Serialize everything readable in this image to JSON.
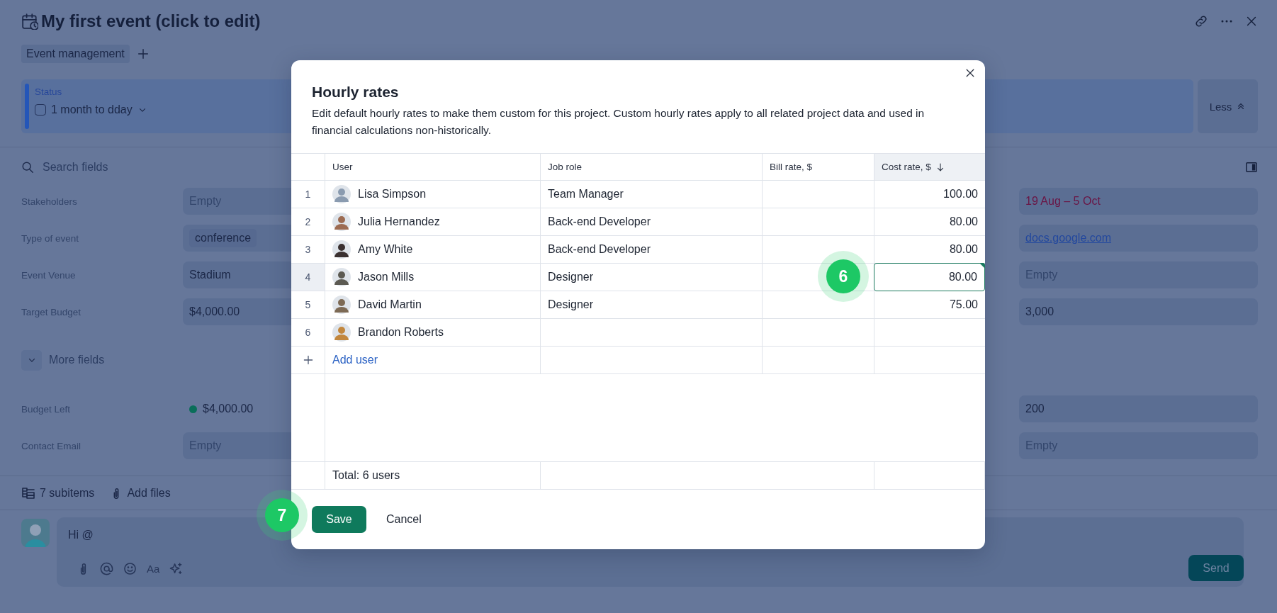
{
  "header": {
    "title": "My first event (click to edit)"
  },
  "tags": [
    {
      "label": "Event management"
    }
  ],
  "status": {
    "label": "Status",
    "value": "1 month to dday",
    "checked": false
  },
  "less_button": "Less",
  "search": {
    "placeholder": "Search fields"
  },
  "field_groups": [
    {
      "fields": [
        {
          "label": "Stakeholders",
          "value": "Empty",
          "kind": "empty"
        },
        {
          "label": "Type of event",
          "value": "conference",
          "kind": "tag"
        },
        {
          "label": "Event Venue",
          "value": "Stadium",
          "kind": "text"
        },
        {
          "label": "Target Budget",
          "value": "$4,000.00",
          "kind": "text"
        }
      ],
      "right_fields": [
        {
          "value": "19 Aug – 5 Oct",
          "kind": "date"
        },
        {
          "value": "docs.google.com",
          "kind": "link"
        },
        {
          "value": "Empty",
          "kind": "empty"
        },
        {
          "value": "3,000",
          "kind": "text"
        }
      ]
    },
    {
      "fields": [
        {
          "label": "Budget Left",
          "value": "$4,000.00",
          "kind": "dot",
          "color": "#0a6e5a"
        },
        {
          "label": "Contact Email",
          "value": "Empty",
          "kind": "empty"
        }
      ],
      "right_fields": [
        {
          "value": "200",
          "kind": "text"
        },
        {
          "value": "Empty",
          "kind": "empty"
        }
      ]
    }
  ],
  "more_fields": "More fields",
  "footer": {
    "subitems": "7 subitems",
    "add_files": "Add files"
  },
  "comment": {
    "value": "Hi @",
    "format_button": "Aa",
    "send": "Send"
  },
  "modal": {
    "title": "Hourly rates",
    "description": "Edit default hourly rates to make them custom for this project. Custom hourly rates apply to all related project data and used in financial calculations non-historically.",
    "columns": [
      {
        "label": "User",
        "sorted": false
      },
      {
        "label": "Job role",
        "sorted": false
      },
      {
        "label": "Bill rate, $",
        "sorted": false
      },
      {
        "label": "Cost rate, $",
        "sorted": true
      }
    ],
    "rows": [
      {
        "index": "1",
        "user": "Lisa Simpson",
        "job_role": "Team Manager",
        "cost_rate": "100.00",
        "selected": false
      },
      {
        "index": "2",
        "user": "Julia Hernandez",
        "job_role": "Back-end Developer",
        "cost_rate": "80.00",
        "selected": false
      },
      {
        "index": "3",
        "user": "Amy White",
        "job_role": "Back-end Developer",
        "cost_rate": "80.00",
        "selected": false
      },
      {
        "index": "4",
        "user": "Jason Mills",
        "job_role": "Designer",
        "cost_rate": "80.00",
        "selected": true
      },
      {
        "index": "5",
        "user": "David Martin",
        "job_role": "Designer",
        "cost_rate": "75.00",
        "selected": false
      },
      {
        "index": "6",
        "user": "Brandon Roberts",
        "selected": false
      }
    ],
    "add_user": "Add user",
    "total": "Total: 6 users",
    "save": "Save",
    "cancel": "Cancel"
  },
  "step_badges": [
    {
      "label": "6"
    },
    {
      "label": "7"
    }
  ]
}
